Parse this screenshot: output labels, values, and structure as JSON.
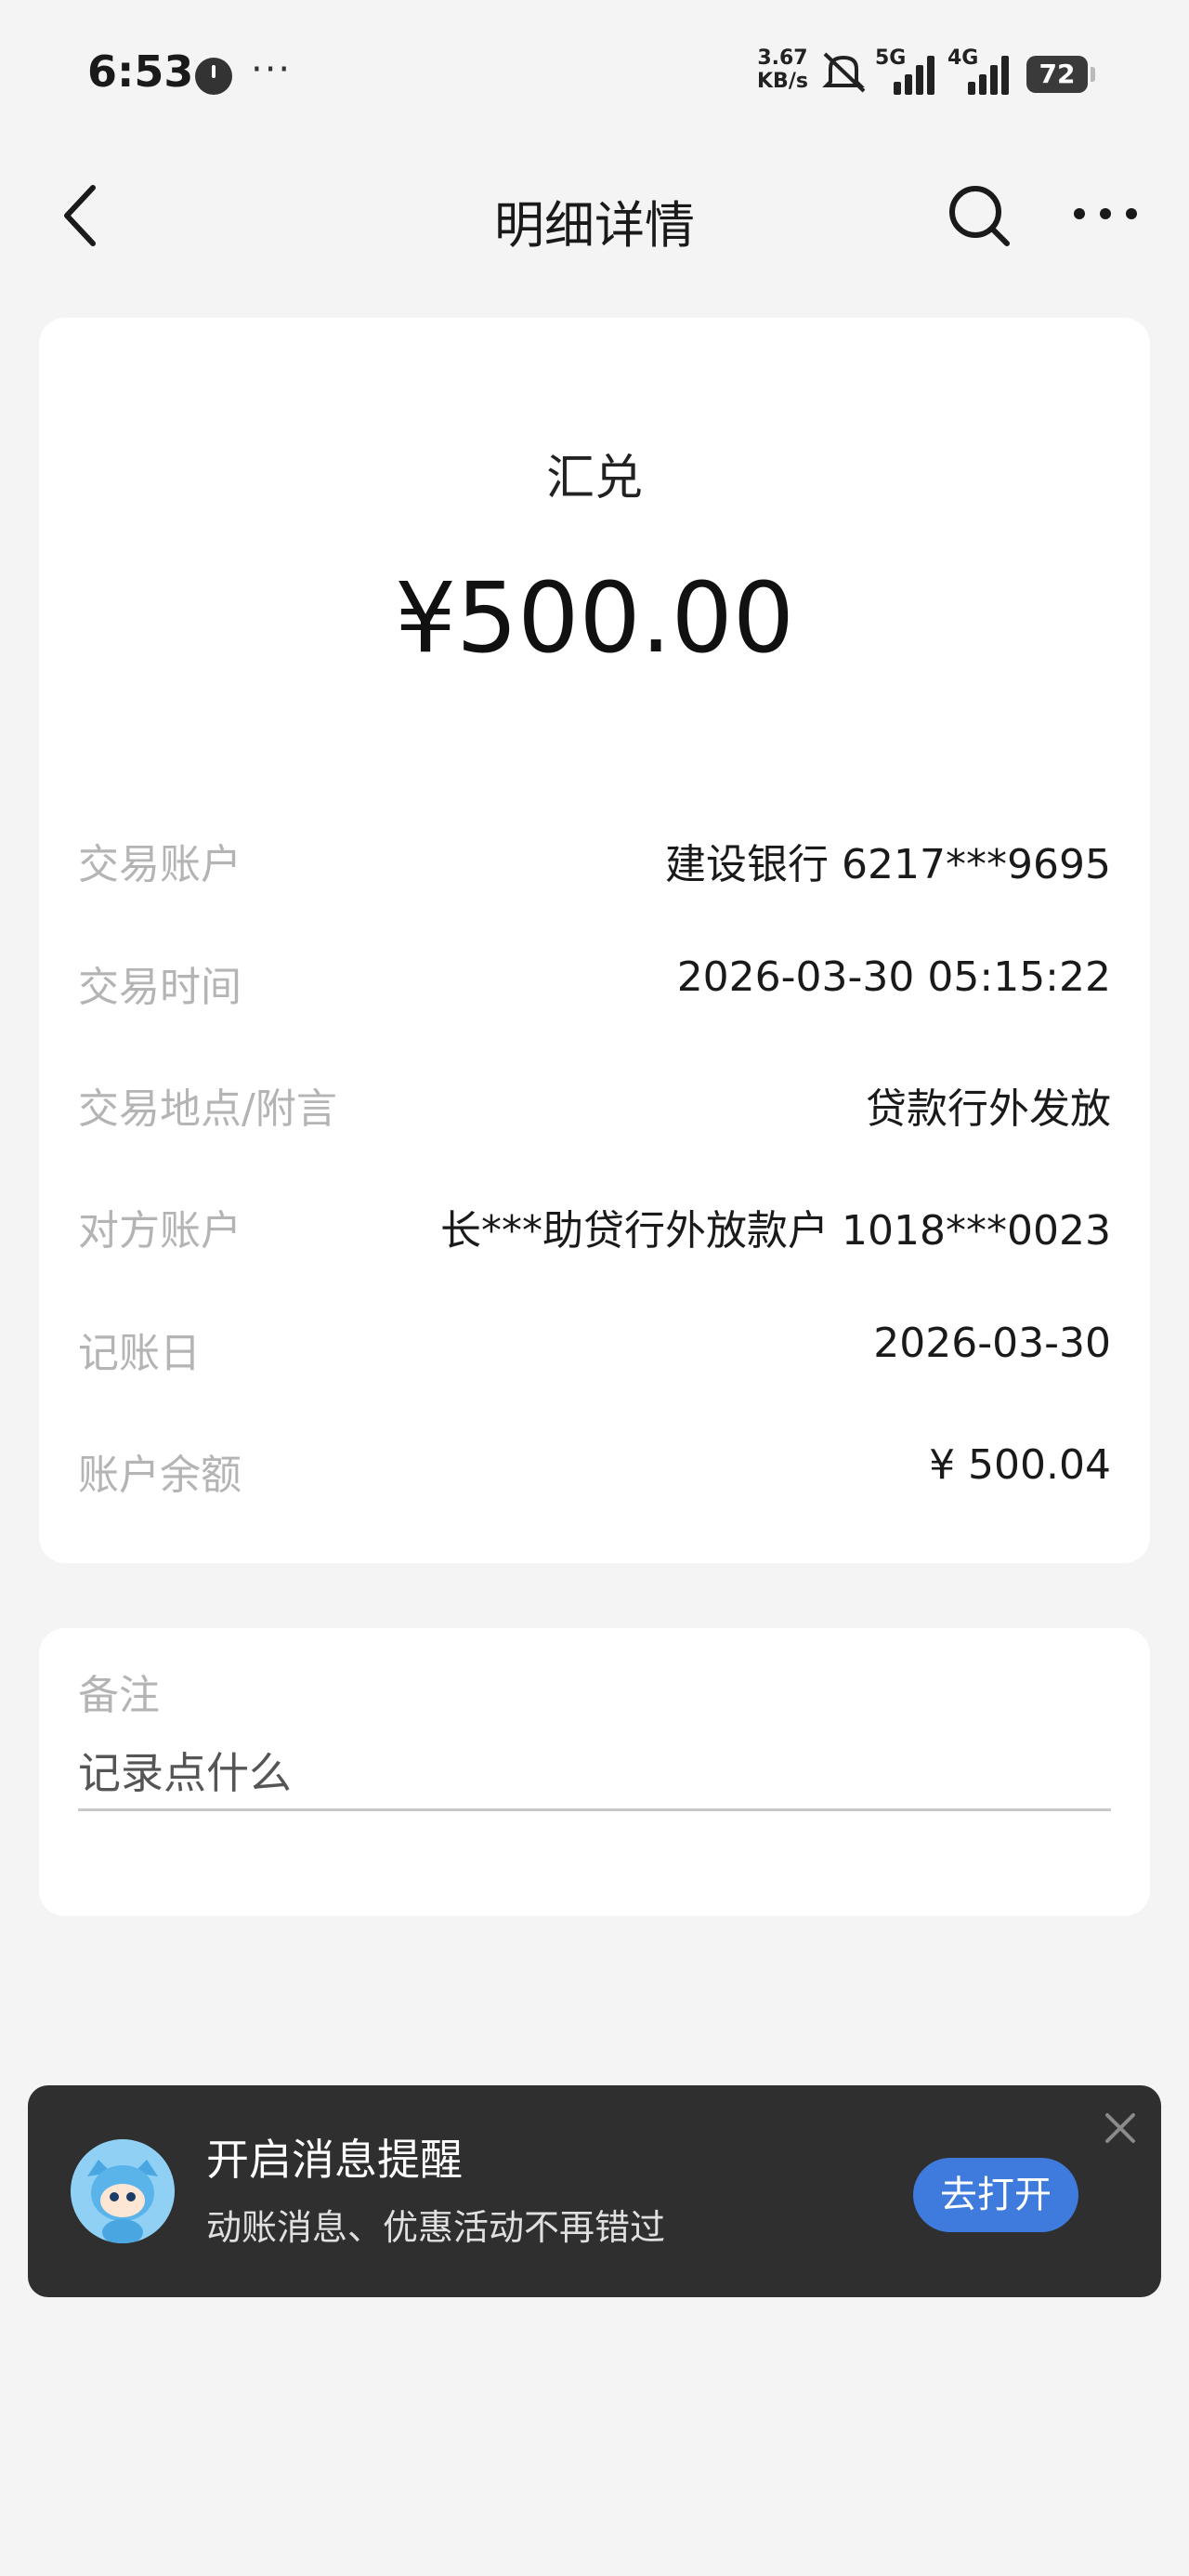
{
  "status_bar": {
    "time": "6:53",
    "dots": "···",
    "net_speed_value": "3.67",
    "net_speed_unit": "KB/s",
    "sim1_tag": "5G",
    "sim2_tag": "4G",
    "battery": "72"
  },
  "nav": {
    "title": "明细详情"
  },
  "transaction": {
    "type": "汇兑",
    "amount": "¥500.00",
    "rows": [
      {
        "label": "交易账户",
        "value": "建设银行 6217***9695"
      },
      {
        "label": "交易时间",
        "value": "2026-03-30 05:15:22"
      },
      {
        "label": "交易地点/附言",
        "value": "贷款行外发放"
      },
      {
        "label": "对方账户",
        "value": "长***助贷行外放款户 1018***0023"
      },
      {
        "label": "记账日",
        "value": "2026-03-30"
      },
      {
        "label": "账户余额",
        "value": "¥ 500.04"
      }
    ]
  },
  "note": {
    "title": "备注",
    "placeholder": "记录点什么",
    "value": ""
  },
  "banner": {
    "title": "开启消息提醒",
    "subtitle": "动账消息、优惠活动不再错过",
    "button_label": "去打开"
  },
  "colors": {
    "background": "#f4f4f4",
    "card": "#ffffff",
    "label_gray": "#b4b4b4",
    "banner_bg": "#2f2f2f",
    "accent_blue": "#3e7bdc"
  },
  "icons": {
    "back": "chevron-left-icon",
    "search": "search-icon",
    "more": "more-horizontal-icon",
    "close": "close-icon",
    "mute": "bell-off-icon"
  }
}
